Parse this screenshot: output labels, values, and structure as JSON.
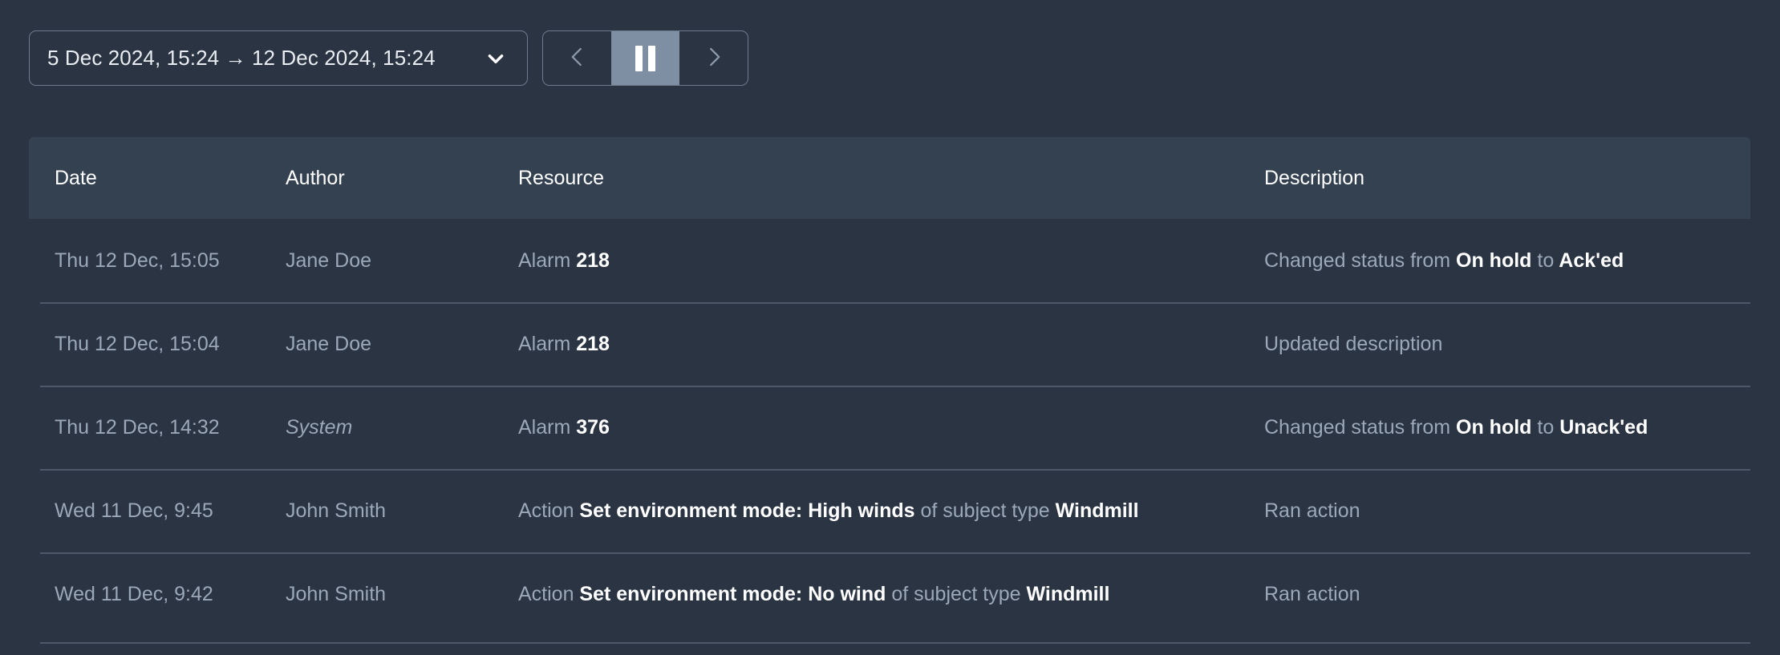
{
  "toolbar": {
    "date_range": {
      "value": "5 Dec 2024, 15:24 → 12 Dec 2024, 15:24",
      "chevron_icon": "chevron-down-icon"
    },
    "playback": {
      "prev_label": "‹",
      "prev_icon": "chevron-left-icon",
      "pause_icon": "pause-icon",
      "next_icon": "chevron-right-icon",
      "active": "pause"
    }
  },
  "table": {
    "columns": [
      {
        "key": "date",
        "label": "Date"
      },
      {
        "key": "author",
        "label": "Author"
      },
      {
        "key": "resource",
        "label": "Resource"
      },
      {
        "key": "description",
        "label": "Description"
      }
    ],
    "rows": [
      {
        "date": "Thu 12 Dec, 15:05",
        "author": "Jane Doe",
        "author_style": "normal",
        "resource": [
          {
            "text": "Alarm",
            "style": "muted"
          },
          {
            "text": "218",
            "style": "strong"
          }
        ],
        "description": [
          {
            "text": "Changed status from",
            "style": "muted"
          },
          {
            "text": "On hold",
            "style": "strong"
          },
          {
            "text": "to",
            "style": "muted"
          },
          {
            "text": "Ack'ed",
            "style": "strong"
          }
        ]
      },
      {
        "date": "Thu 12 Dec, 15:04",
        "author": "Jane Doe",
        "author_style": "normal",
        "resource": [
          {
            "text": "Alarm",
            "style": "muted"
          },
          {
            "text": "218",
            "style": "strong"
          }
        ],
        "description": [
          {
            "text": "Updated description",
            "style": "muted"
          }
        ]
      },
      {
        "date": "Thu 12 Dec, 14:32",
        "author": "System",
        "author_style": "italic",
        "resource": [
          {
            "text": "Alarm",
            "style": "muted"
          },
          {
            "text": "376",
            "style": "strong"
          }
        ],
        "description": [
          {
            "text": "Changed status from",
            "style": "muted"
          },
          {
            "text": "On hold",
            "style": "strong"
          },
          {
            "text": "to",
            "style": "muted"
          },
          {
            "text": "Unack'ed",
            "style": "strong"
          }
        ]
      },
      {
        "date": "Wed 11 Dec, 9:45",
        "author": "John Smith",
        "author_style": "normal",
        "resource": [
          {
            "text": "Action",
            "style": "muted"
          },
          {
            "text": "Set environment mode: High winds",
            "style": "strong"
          },
          {
            "text": "of subject type",
            "style": "muted"
          },
          {
            "text": "Windmill",
            "style": "strong"
          }
        ],
        "description": [
          {
            "text": "Ran action",
            "style": "muted"
          }
        ]
      },
      {
        "date": "Wed 11 Dec, 9:42",
        "author": "John Smith",
        "author_style": "normal",
        "resource": [
          {
            "text": "Action",
            "style": "muted"
          },
          {
            "text": "Set environment mode: No wind",
            "style": "strong"
          },
          {
            "text": "of subject type",
            "style": "muted"
          },
          {
            "text": "Windmill",
            "style": "strong"
          }
        ],
        "description": [
          {
            "text": "Ran action",
            "style": "muted"
          }
        ]
      }
    ]
  },
  "colors": {
    "background": "#2b3442",
    "header_background": "#344150",
    "separator": "#4b586a",
    "text_muted": "#9aa8b8",
    "text_strong": "#ffffff",
    "control_border": "#6d7b8d",
    "control_active": "#7e8ea3"
  }
}
